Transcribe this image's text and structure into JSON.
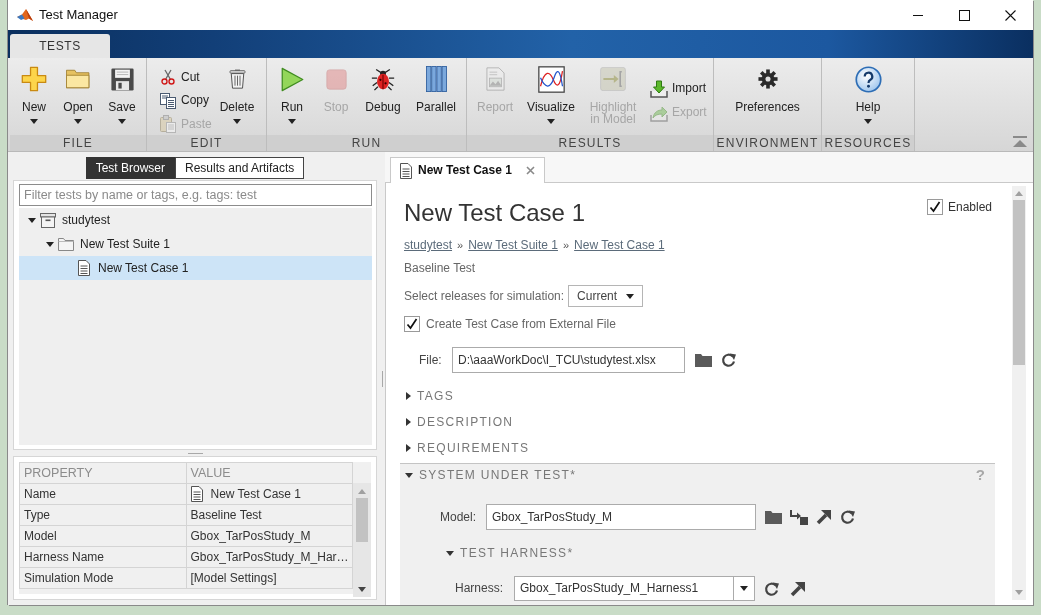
{
  "window": {
    "title": "Test Manager"
  },
  "ribbon": {
    "tabs": [
      {
        "label": "TESTS",
        "selected": true
      }
    ],
    "groups": [
      {
        "label": "FILE",
        "buttons": [
          {
            "kind": "large",
            "label": "New",
            "menu": true,
            "disabled": false
          },
          {
            "kind": "large",
            "label": "Open",
            "menu": true,
            "disabled": false
          },
          {
            "kind": "large",
            "label": "Save",
            "menu": true,
            "disabled": false
          }
        ]
      },
      {
        "label": "EDIT",
        "buttons": [
          {
            "kind": "small",
            "label": "Cut",
            "menu": false,
            "disabled": false
          },
          {
            "kind": "small",
            "label": "Copy",
            "menu": false,
            "disabled": false
          },
          {
            "kind": "small",
            "label": "Paste",
            "menu": false,
            "disabled": true
          },
          {
            "kind": "large",
            "label": "Delete",
            "menu": true,
            "disabled": false
          }
        ]
      },
      {
        "label": "RUN",
        "buttons": [
          {
            "kind": "large",
            "label": "Run",
            "menu": true,
            "disabled": false
          },
          {
            "kind": "large",
            "label": "Stop",
            "menu": false,
            "disabled": true
          },
          {
            "kind": "large",
            "label": "Debug",
            "menu": false,
            "disabled": false
          },
          {
            "kind": "large",
            "label": "Parallel",
            "menu": false,
            "disabled": false
          }
        ]
      },
      {
        "label": "RESULTS",
        "buttons": [
          {
            "kind": "large",
            "label": "Report",
            "menu": false,
            "disabled": true
          },
          {
            "kind": "large",
            "label": "Visualize",
            "menu": true,
            "disabled": false
          },
          {
            "kind": "large",
            "label": "Highlight in Model",
            "menu": false,
            "disabled": true
          },
          {
            "kind": "small",
            "label": "Import",
            "menu": false,
            "disabled": false
          },
          {
            "kind": "small",
            "label": "Export",
            "menu": false,
            "disabled": true
          }
        ]
      },
      {
        "label": "ENVIRONMENT",
        "buttons": [
          {
            "kind": "large",
            "label": "Preferences",
            "menu": false,
            "disabled": false
          }
        ]
      },
      {
        "label": "RESOURCES",
        "buttons": [
          {
            "kind": "large",
            "label": "Help",
            "menu": true,
            "disabled": false
          }
        ]
      }
    ]
  },
  "browser": {
    "tabs": [
      {
        "label": "Test Browser",
        "selected": true
      },
      {
        "label": "Results and Artifacts",
        "selected": false
      }
    ],
    "filter": {
      "placeholder": "Filter tests by name or tags, e.g. tags: test"
    },
    "tree": [
      {
        "label": "studytest",
        "kind": "file",
        "expanded": true,
        "selected": false,
        "children": [
          {
            "label": "New Test Suite 1",
            "kind": "suite",
            "expanded": true,
            "selected": false,
            "children": [
              {
                "label": "New Test Case 1",
                "kind": "case",
                "selected": true
              }
            ]
          }
        ]
      }
    ]
  },
  "properties": {
    "columns": [
      "PROPERTY",
      "VALUE"
    ],
    "rows": [
      {
        "property": "Name",
        "value": "New Test Case 1",
        "kind": "case"
      },
      {
        "property": "Type",
        "value": "Baseline Test",
        "kind": "text"
      },
      {
        "property": "Model",
        "value": "Gbox_TarPosStudy_M",
        "kind": "text"
      },
      {
        "property": "Harness Name",
        "value": "Gbox_TarPosStudy_M_Har…",
        "kind": "text"
      },
      {
        "property": "Simulation Mode",
        "value": "[Model Settings]",
        "kind": "text"
      }
    ]
  },
  "editor": {
    "tabs": [
      {
        "label": "New Test Case 1",
        "selected": true
      }
    ],
    "title": "New Test Case 1",
    "enabled": {
      "label": "Enabled",
      "checked": true
    },
    "breadcrumb": [
      {
        "kind": "link",
        "text": "studytest"
      },
      {
        "kind": "separator",
        "text": "»"
      },
      {
        "kind": "link",
        "text": "New Test Suite 1"
      },
      {
        "kind": "separator",
        "text": "»"
      },
      {
        "kind": "link",
        "text": "New Test Case 1"
      }
    ],
    "test_type": "Baseline Test",
    "releases": {
      "label": "Select releases for simulation:",
      "value": "Current"
    },
    "external_file": {
      "label": "Create Test Case from External File",
      "checked": true
    },
    "file": {
      "label": "File:",
      "value": "D:\\aaaWorkDoc\\I_TCU\\studytest.xlsx"
    },
    "sections": [
      {
        "label": "TAGS",
        "expanded": false
      },
      {
        "label": "DESCRIPTION",
        "expanded": false
      },
      {
        "label": "REQUIREMENTS",
        "expanded": false
      }
    ],
    "system_under_test": {
      "label": "SYSTEM UNDER TEST*",
      "expanded": true,
      "help": "?",
      "model": {
        "label": "Model:",
        "value": "Gbox_TarPosStudy_M"
      },
      "test_harness": {
        "label": "TEST HARNESS*",
        "expanded": true,
        "harness": {
          "label": "Harness:",
          "value": "Gbox_TarPosStudy_M_Harness1"
        }
      }
    }
  }
}
